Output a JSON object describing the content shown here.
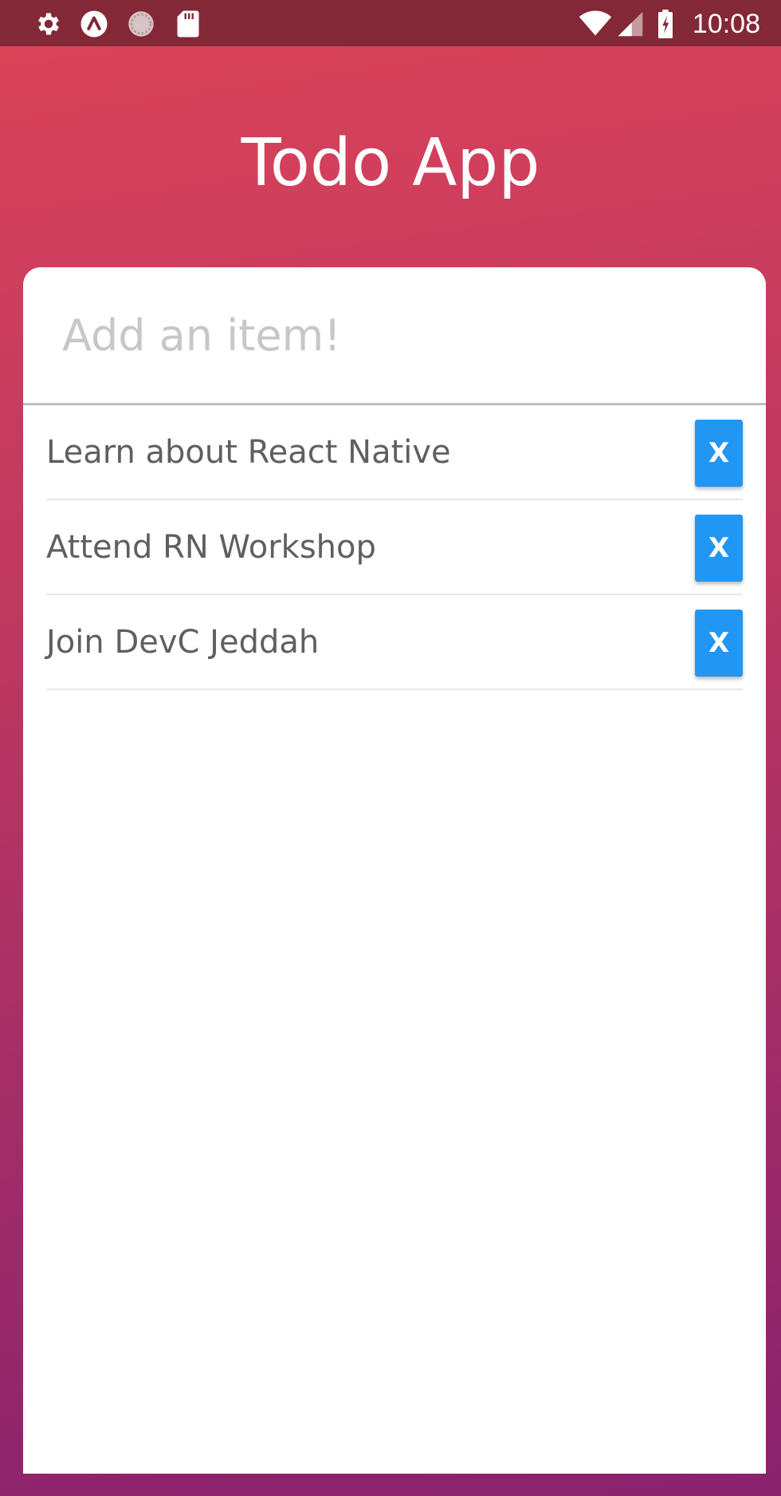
{
  "status_bar": {
    "left_icons": [
      "gear-icon",
      "logo-a-icon",
      "loading-circle-icon",
      "sd-card-icon"
    ],
    "right_icons": [
      "wifi-icon",
      "cell-signal-icon",
      "battery-charging-icon"
    ],
    "time": "10:08"
  },
  "header": {
    "title": "Todo App"
  },
  "input": {
    "placeholder": "Add an item!",
    "value": ""
  },
  "todos": [
    {
      "text": "Learn about React Native",
      "delete_label": "X"
    },
    {
      "text": "Attend RN Workshop",
      "delete_label": "X"
    },
    {
      "text": "Join DevC Jeddah",
      "delete_label": "X"
    }
  ],
  "colors": {
    "status_bar": "#832836",
    "gradient_top": "#dc4456",
    "gradient_bottom": "#8a226e",
    "delete_button": "#2196f3",
    "item_text": "#5f5f5f",
    "placeholder": "#c7c7c7"
  }
}
